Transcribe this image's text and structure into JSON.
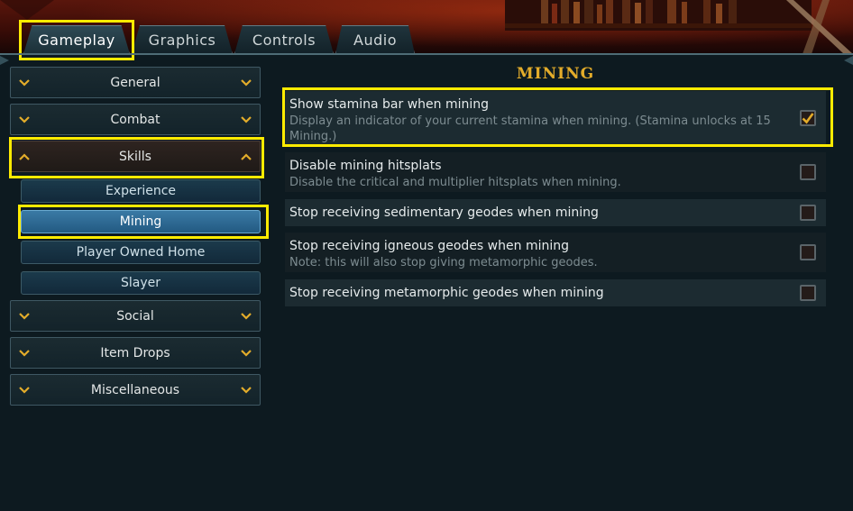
{
  "tabs": [
    {
      "label": "Gameplay",
      "active": true
    },
    {
      "label": "Graphics",
      "active": false
    },
    {
      "label": "Controls",
      "active": false
    },
    {
      "label": "Audio",
      "active": false
    }
  ],
  "nav": {
    "categories": [
      {
        "label": "General",
        "expanded": false
      },
      {
        "label": "Combat",
        "expanded": false
      },
      {
        "label": "Skills",
        "expanded": true
      },
      {
        "label": "Social",
        "expanded": false
      },
      {
        "label": "Item Drops",
        "expanded": false
      },
      {
        "label": "Miscellaneous",
        "expanded": false
      }
    ],
    "skills_sub": [
      {
        "label": "Experience",
        "active": false
      },
      {
        "label": "Mining",
        "active": true
      },
      {
        "label": "Player Owned Home",
        "active": false
      },
      {
        "label": "Slayer",
        "active": false
      }
    ]
  },
  "panel": {
    "title": "MINING",
    "settings": [
      {
        "title": "Show stamina bar when mining",
        "description": "Display an indicator of your current stamina when mining. (Stamina unlocks at 15 Mining.)",
        "checked": true
      },
      {
        "title": "Disable mining hitsplats",
        "description": "Disable the critical and multiplier hitsplats when mining.",
        "checked": false
      },
      {
        "title": "Stop receiving sedimentary geodes when mining",
        "description": "",
        "checked": false
      },
      {
        "title": "Stop receiving igneous geodes when mining",
        "description": "Note: this will also stop giving metamorphic geodes.",
        "checked": false
      },
      {
        "title": "Stop receiving metamorphic geodes when mining",
        "description": "",
        "checked": false
      }
    ]
  },
  "colors": {
    "highlight": "#ffeb00",
    "section_title": "#e3ac2a",
    "chevron": "#e3ac2a",
    "active_subitem": "#2f6d97",
    "checkmark": "#e3ac2a"
  },
  "icons": {
    "category_expander": "chevron-down-icon",
    "category_collapser": "chevron-up-icon",
    "checkbox_checked": "checkmark-icon"
  }
}
